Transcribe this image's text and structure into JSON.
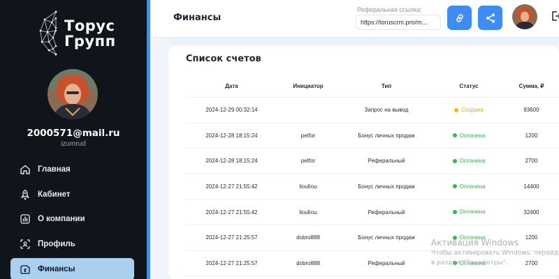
{
  "brand": {
    "name_line1": "Торус",
    "name_line2": "Групп"
  },
  "user": {
    "email": "2000571@mail.ru",
    "login": "izumrud"
  },
  "nav": [
    {
      "label": "Главная",
      "icon": "home-icon"
    },
    {
      "label": "Кабинет",
      "icon": "rocket-icon"
    },
    {
      "label": "О компании",
      "icon": "chart-icon"
    },
    {
      "label": "Профиль",
      "icon": "profile-scan-icon"
    },
    {
      "label": "Финансы",
      "icon": "wallet-icon",
      "active": true
    }
  ],
  "header": {
    "title": "Финансы",
    "ref_label": "Реферальная ссылка:",
    "ref_value": "https://toruscrm.pro/m..."
  },
  "accounts": {
    "title": "Список счетов",
    "columns": [
      "Дата",
      "Инициатор",
      "Тип",
      "Статус",
      "Сумма, ₽"
    ],
    "rows": [
      {
        "date": "2024-12-29 00:32:14",
        "initiator": "",
        "type": "Запрос на вывод",
        "status": "Создана",
        "status_kind": "created",
        "amount": "93600"
      },
      {
        "date": "2024-12-28 18:15:24",
        "initiator": "petfor",
        "type": "Бонус личных продаж",
        "status": "Оплачена",
        "status_kind": "paid",
        "amount": "1200"
      },
      {
        "date": "2024-12-28 18:15:24",
        "initiator": "petfor",
        "type": "Реферальный",
        "status": "Оплачена",
        "status_kind": "paid",
        "amount": "2700"
      },
      {
        "date": "2024-12-27 21:55:42",
        "initiator": "lioulìou",
        "type": "Бонус личных продаж",
        "status": "Оплачена",
        "status_kind": "paid",
        "amount": "14400"
      },
      {
        "date": "2024-12-27 21:55:42",
        "initiator": "lioulìou",
        "type": "Реферальный",
        "status": "Оплачена",
        "status_kind": "paid",
        "amount": "32400"
      },
      {
        "date": "2024-12-27 21:25:57",
        "initiator": "dobro888",
        "type": "Бонус личных продаж",
        "status": "Оплачена",
        "status_kind": "paid",
        "amount": "1200"
      },
      {
        "date": "2024-12-27 21:25:57",
        "initiator": "dobro888",
        "type": "Реферальный",
        "status": "Оплачена",
        "status_kind": "paid",
        "amount": "2700"
      }
    ]
  },
  "watermark": {
    "title": "Активация Windows",
    "line1": "Чтобы активировать Windows, перейдите",
    "line2": "в раздел \"Параметры\"."
  },
  "colors": {
    "sidebar_bg": "#10151c",
    "accent": "#3f8df4",
    "active_nav": "#a9d0ee",
    "paid": "#35b84a",
    "created": "#f2b90c"
  }
}
